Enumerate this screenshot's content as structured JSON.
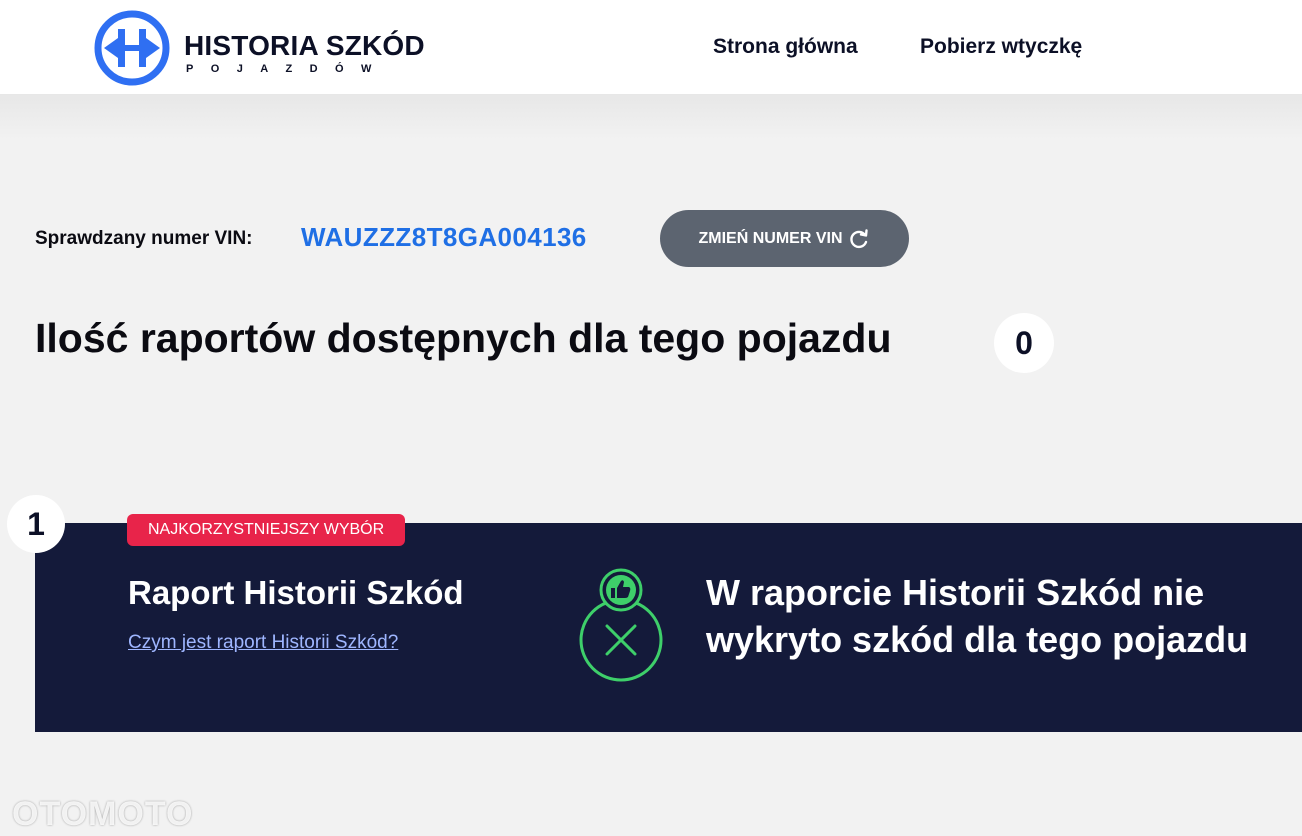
{
  "header": {
    "logo_title": "HISTORIA SZKÓD",
    "logo_subtitle": "POJAZDÓW",
    "nav": {
      "home": "Strona główna",
      "plugin": "Pobierz wtyczkę"
    }
  },
  "vin": {
    "label": "Sprawdzany numer VIN:",
    "value": "WAUZZZ8T8GA004136",
    "change_button": "ZMIEŃ NUMER VIN",
    "change_icon": "refresh-icon"
  },
  "reports": {
    "title": "Ilość raportów dostępnych dla tego pojazdu",
    "count": "0"
  },
  "card": {
    "rank": "1",
    "badge": "NAJKORZYSTNIEJSZY WYBÓR",
    "title": "Raport Historii Szkód",
    "link": "Czym jest raport Historii Szkód?",
    "status_icon": "thumbs-up-no-damage-icon",
    "result": "W raporcie Historii Szkód nie wykryto szkód dla tego pojazdu"
  },
  "watermark": "OTOMOTO",
  "colors": {
    "accent_blue": "#1f6fe5",
    "card_bg": "#141a3a",
    "badge_red": "#e8244a",
    "status_green": "#3ecf6a",
    "button_gray": "#5c6470"
  }
}
